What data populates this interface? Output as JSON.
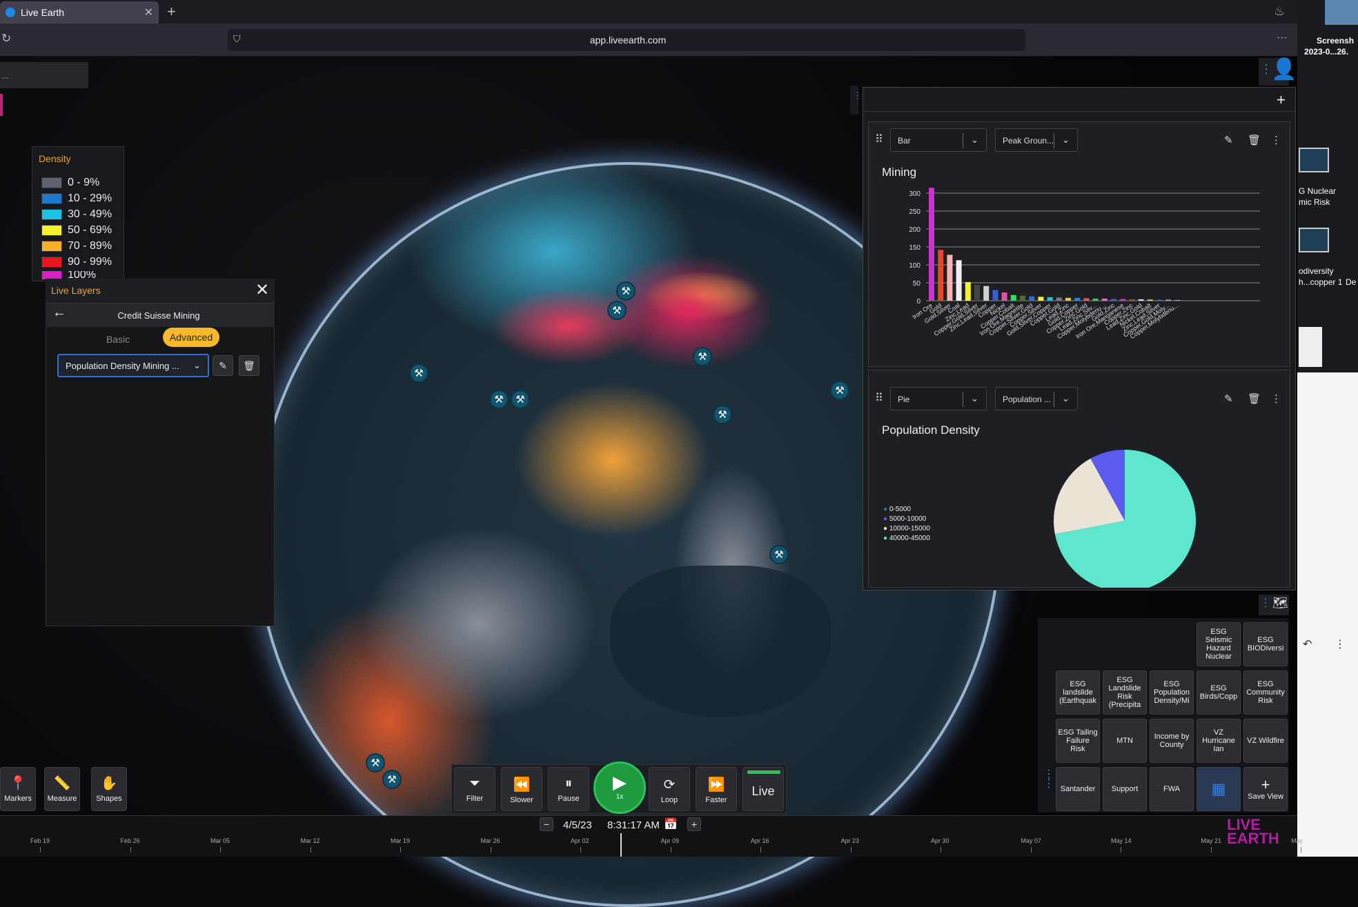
{
  "browser": {
    "tab_title": "Live Earth",
    "url": "app.liveearth.com"
  },
  "desktop": {
    "screenshot_label_1": "Screensh",
    "screenshot_label_2": "2023-0...26.",
    "side_labels": [
      "G Nuclear",
      "mic Risk",
      "odiversity",
      "h...copper 1",
      "De"
    ]
  },
  "top_left_text": "...",
  "legend": {
    "title": "Density",
    "items": [
      {
        "label": "0 - 9%",
        "color": "#5f6270"
      },
      {
        "label": "10 - 29%",
        "color": "#1f77c9"
      },
      {
        "label": "30 - 49%",
        "color": "#1ec3ea"
      },
      {
        "label": "50 - 69%",
        "color": "#f5f12c"
      },
      {
        "label": "70 - 89%",
        "color": "#f5b12c"
      },
      {
        "label": "90 - 99%",
        "color": "#e8141e"
      },
      {
        "label": "100%",
        "color": "#d81ec8"
      }
    ]
  },
  "live_layers": {
    "title": "Live Layers",
    "subtitle": "Credit Suisse Mining",
    "tab_basic": "Basic",
    "tab_advanced": "Advanced",
    "selected_layer": "Population Density Mining ..."
  },
  "tools": [
    {
      "label": "Markers",
      "icon": "map-pin-icon"
    },
    {
      "label": "Measure",
      "icon": "ruler-icon"
    },
    {
      "label": "Shapes",
      "icon": "shapes-icon"
    }
  ],
  "playback": {
    "filter": "Filter",
    "slower": "Slower",
    "pause": "Pause",
    "speed": "1x",
    "loop": "Loop",
    "faster": "Faster",
    "live": "Live"
  },
  "timeline": {
    "date": "4/5/23",
    "time": "8:31:17 AM",
    "ticks": [
      "Feb 19",
      "Feb 26",
      "Mar 05",
      "Mar 12",
      "Mar 19",
      "Mar 26",
      "Apr 02",
      "Apr 09",
      "Apr 16",
      "Apr 23",
      "Apr 30",
      "May 07",
      "May 14",
      "May 21",
      "May"
    ]
  },
  "chart_cards": [
    {
      "type_select": "Bar",
      "field_select": "Peak Groun..."
    },
    {
      "type_select": "Pie",
      "field_select": "Population ..."
    }
  ],
  "chart_data": [
    {
      "type": "bar",
      "title": "Mining",
      "ylim": [
        0,
        300
      ],
      "yticks": [
        0,
        50,
        100,
        150,
        200,
        250,
        300
      ],
      "categories": [
        "Iron Ore",
        "Gold",
        "Gold,Silver",
        "Coal",
        "Zinc,Lead",
        "Copper,Gold,Silver",
        "Zinc,Lead,Silver",
        "Copper",
        "Nickel",
        "Copper,Cobalt",
        "Iron Ore,Magnetite",
        "Copper,Silver,Gold",
        "Copper,Silver",
        "Gold,Silver,Copper",
        "Copper,Gold",
        "Lead,Zinc",
        "Gold,Copper",
        "Copper,Zinc,Gold",
        "Lead,Zinc,Silv...",
        "Copper,Molybdenu...",
        "Gold,Zinc",
        "Iron Ore,Manganese",
        "Copper,Zinc",
        "Lead,Zinc,Gold",
        "Nickel,Cobalt",
        "Zinc,Lead,Silver",
        "Copper,Gold,Moly...",
        "Copper,Molybdenu..."
      ],
      "values": [
        315,
        142,
        128,
        113,
        52,
        44,
        41,
        30,
        23,
        16,
        14,
        12,
        11,
        10,
        9,
        8,
        8,
        7,
        6,
        6,
        5,
        5,
        4,
        4,
        3,
        3,
        3,
        2
      ],
      "colors": [
        "#cc33cc",
        "#e04a2a",
        "#f5b5b5",
        "#f0f0f0",
        "#f5f12c",
        "#444",
        "#d0d0d0",
        "#3b5bdb",
        "#e055aa",
        "#2ee05a",
        "#556b2f",
        "#2d6fd2",
        "#f5f12c",
        "#19c3e6",
        "#7a7a7a",
        "#e6c65c",
        "#1e88e5",
        "#e05a5a",
        "#2ecc71",
        "#e06bd9",
        "#3b5bdb",
        "#cc33cc",
        "#8a5a2a",
        "#e0e0e0",
        "#f5f12c",
        "#2d6fd2",
        "#aaaaaa",
        "#f5b12c"
      ]
    },
    {
      "type": "pie",
      "title": "Population Density",
      "labels": [
        "0-5000",
        "5000-10000",
        "10000-15000",
        "40000-45000"
      ],
      "values": [
        0,
        8,
        20,
        72
      ],
      "colors": [
        "#2d7a7a",
        "#5b5bf0",
        "#e9e4d6",
        "#5ee6cf"
      ]
    }
  ],
  "esg_buttons": [
    [
      "ESG Seismic Hazard Nuclear",
      "ESG BIODiversi"
    ],
    [
      "ESG landslide (Earthquak",
      "ESG Landslide Risk (Precipita",
      "ESG Population Density/Mi",
      "ESG Birds/Copp",
      "ESG Community Risk"
    ],
    [
      "ESG Tailing Failure Risk",
      "MTN",
      "Income by County",
      "VZ Hurricane Ian",
      "VZ Wildfire"
    ],
    [
      "Santander",
      "Support",
      "FWA",
      "",
      "Save View"
    ]
  ],
  "logo": {
    "line1": "LIVE",
    "line2": "EARTH"
  }
}
